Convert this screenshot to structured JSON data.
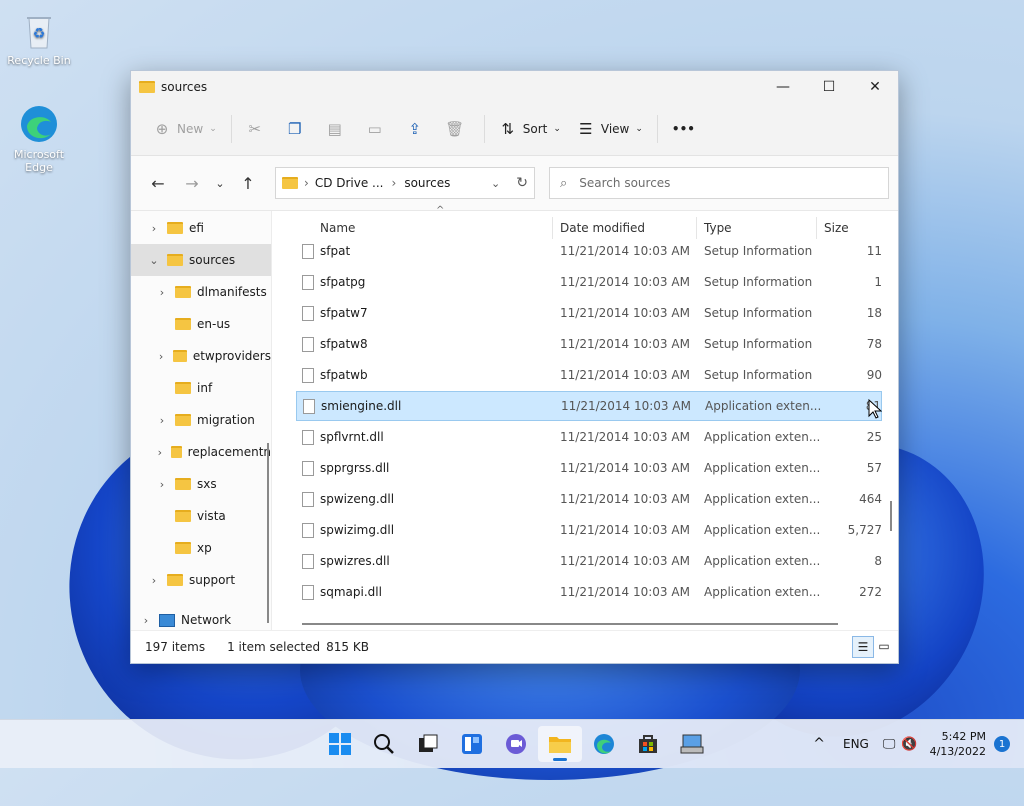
{
  "desktop": {
    "icons": [
      {
        "label": "Recycle Bin"
      },
      {
        "label": "Microsoft Edge"
      }
    ]
  },
  "window": {
    "title": "sources",
    "controls": {
      "minimize": "—",
      "maximize": "☐",
      "close": "✕"
    }
  },
  "toolbar": {
    "new_label": "New",
    "sort_label": "Sort",
    "view_label": "View",
    "more_label": "•••"
  },
  "address": {
    "segments": [
      "CD Drive ...",
      "sources"
    ],
    "search_placeholder": "Search sources"
  },
  "nav_pane": {
    "items": [
      {
        "label": "efi",
        "level": 1,
        "expandable": true
      },
      {
        "label": "sources",
        "level": 1,
        "expandable": true,
        "expanded": true,
        "selected": true
      },
      {
        "label": "dlmanifests",
        "level": 2,
        "expandable": true
      },
      {
        "label": "en-us",
        "level": 2,
        "expandable": false
      },
      {
        "label": "etwproviders",
        "level": 2,
        "expandable": true
      },
      {
        "label": "inf",
        "level": 2,
        "expandable": false
      },
      {
        "label": "migration",
        "level": 2,
        "expandable": true
      },
      {
        "label": "replacementn",
        "level": 2,
        "expandable": true
      },
      {
        "label": "sxs",
        "level": 2,
        "expandable": true
      },
      {
        "label": "vista",
        "level": 2,
        "expandable": false
      },
      {
        "label": "xp",
        "level": 2,
        "expandable": false
      },
      {
        "label": "support",
        "level": 1,
        "expandable": true
      },
      {
        "label": "Network",
        "level": 0,
        "expandable": true
      }
    ]
  },
  "file_list": {
    "columns": [
      "Name",
      "Date modified",
      "Type",
      "Size"
    ],
    "rows": [
      {
        "name": "sfpat",
        "date": "11/21/2014 10:03 AM",
        "type": "Setup Information",
        "size": "11"
      },
      {
        "name": "sfpatpg",
        "date": "11/21/2014 10:03 AM",
        "type": "Setup Information",
        "size": "1"
      },
      {
        "name": "sfpatw7",
        "date": "11/21/2014 10:03 AM",
        "type": "Setup Information",
        "size": "18"
      },
      {
        "name": "sfpatw8",
        "date": "11/21/2014 10:03 AM",
        "type": "Setup Information",
        "size": "78"
      },
      {
        "name": "sfpatwb",
        "date": "11/21/2014 10:03 AM",
        "type": "Setup Information",
        "size": "90"
      },
      {
        "name": "smiengine.dll",
        "date": "11/21/2014 10:03 AM",
        "type": "Application exten...",
        "size": "81",
        "selected": true
      },
      {
        "name": "spflvrnt.dll",
        "date": "11/21/2014 10:03 AM",
        "type": "Application exten...",
        "size": "25"
      },
      {
        "name": "spprgrss.dll",
        "date": "11/21/2014 10:03 AM",
        "type": "Application exten...",
        "size": "57"
      },
      {
        "name": "spwizeng.dll",
        "date": "11/21/2014 10:03 AM",
        "type": "Application exten...",
        "size": "464"
      },
      {
        "name": "spwizimg.dll",
        "date": "11/21/2014 10:03 AM",
        "type": "Application exten...",
        "size": "5,727"
      },
      {
        "name": "spwizres.dll",
        "date": "11/21/2014 10:03 AM",
        "type": "Application exten...",
        "size": "8"
      },
      {
        "name": "sqmapi.dll",
        "date": "11/21/2014 10:03 AM",
        "type": "Application exten...",
        "size": "272"
      }
    ]
  },
  "status_bar": {
    "item_count": "197 items",
    "selection": "1 item selected",
    "selection_size": "815 KB"
  },
  "taskbar": {
    "apps": [
      "start-icon",
      "search-icon",
      "task-view-icon",
      "widgets-icon",
      "chat-icon",
      "file-explorer-icon",
      "edge-icon",
      "store-icon",
      "setup-icon"
    ],
    "tray": {
      "language": "ENG",
      "time": "5:42 PM",
      "date": "4/13/2022",
      "notifications": "1"
    }
  }
}
